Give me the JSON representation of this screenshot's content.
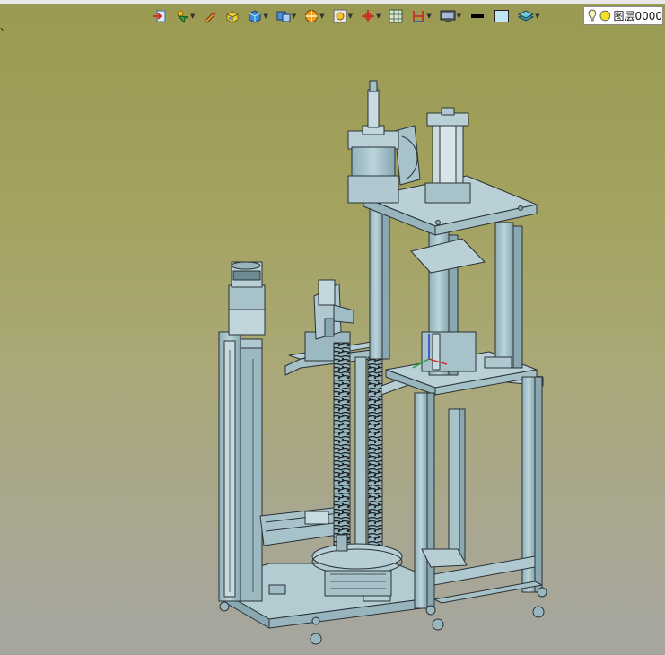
{
  "corner_mark": "、",
  "toolbar": {
    "buttons": [
      {
        "name": "exit-sketch-icon"
      },
      {
        "name": "select-filter-icon"
      },
      {
        "name": "pencil-icon"
      },
      {
        "name": "part-icon"
      },
      {
        "name": "view-cube-icon"
      },
      {
        "name": "display-style-icon"
      },
      {
        "name": "section-view-icon"
      },
      {
        "name": "view-settings-icon"
      },
      {
        "name": "coordinate-axis-icon"
      },
      {
        "name": "grid-icon"
      },
      {
        "name": "dimension-icon"
      },
      {
        "name": "monitor-icon"
      },
      {
        "name": "line-color-icon"
      },
      {
        "name": "fill-color-icon"
      },
      {
        "name": "layer-stack-icon"
      }
    ]
  },
  "layer": {
    "name": "图层0000"
  },
  "colors": {
    "machine": "#a9c4cc",
    "edge": "#2a3236"
  }
}
